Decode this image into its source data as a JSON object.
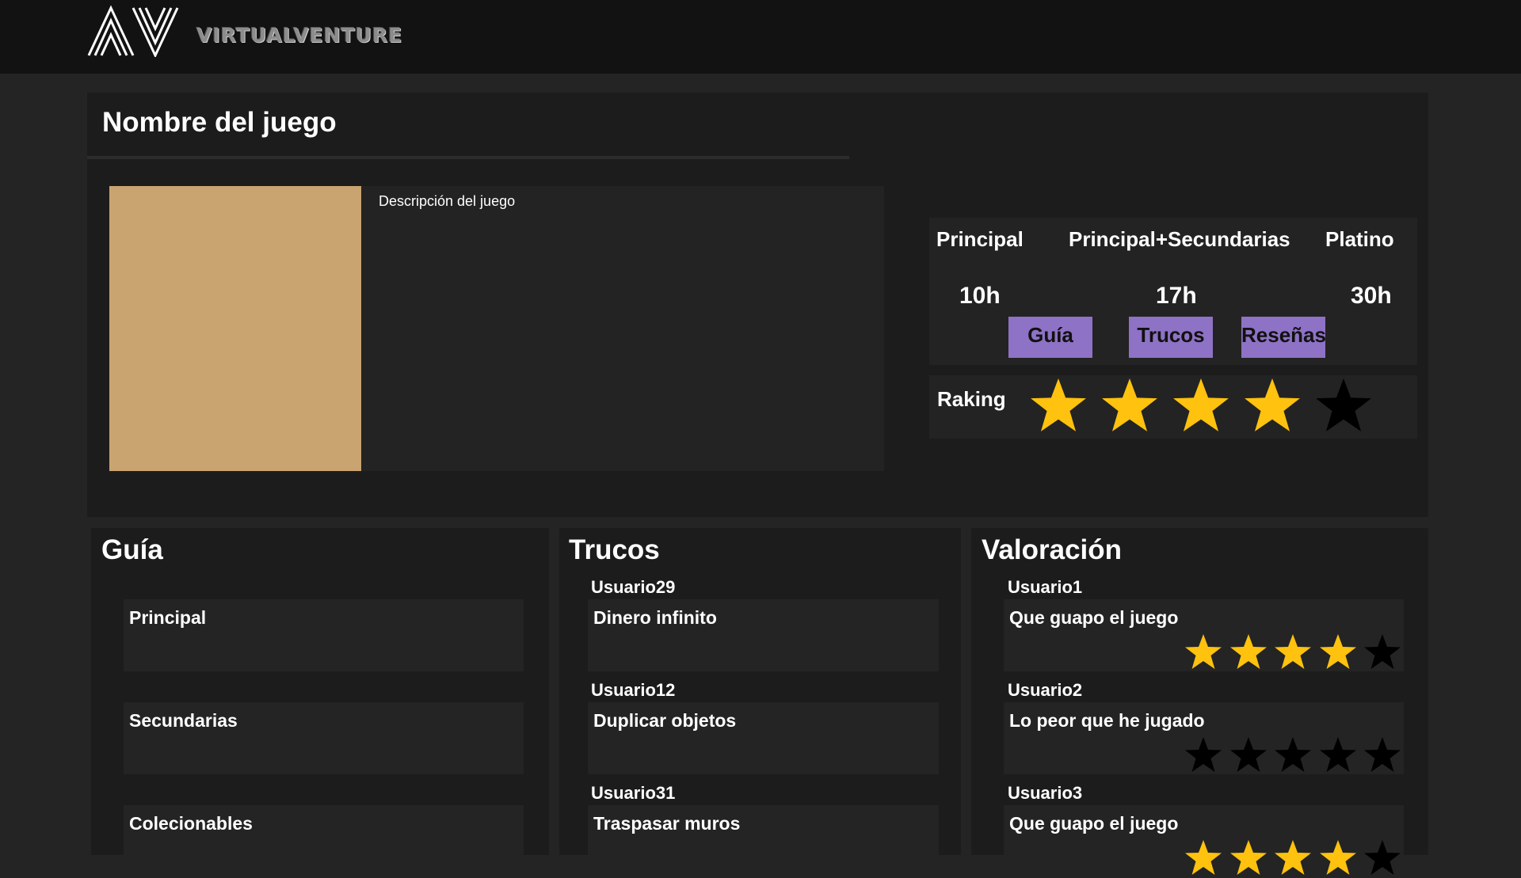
{
  "app": {
    "brand": "VIRTUALVENTURE",
    "logo_icon": "av-logo-icon"
  },
  "game": {
    "title": "Nombre del juego",
    "description": "Descripción del juego",
    "cover_color": "#c9a471"
  },
  "times": {
    "main_label": "Principal",
    "main_value": "10h",
    "extra_label": "Principal+Secundarias",
    "extra_value": "17h",
    "platinum_label": "Platino",
    "platinum_value": "30h"
  },
  "tabs": {
    "guide": "Guía",
    "tricks": "Trucos",
    "reviews": "Reseñas"
  },
  "ranking": {
    "label": "Raking",
    "stars": 4,
    "max": 5
  },
  "guide_section": {
    "title": "Guía",
    "items": [
      "Principal",
      "Secundarias",
      "Colecionables"
    ]
  },
  "tricks_section": {
    "title": "Trucos",
    "items": [
      {
        "user": "Usuario29",
        "text": "Dinero infinito"
      },
      {
        "user": "Usuario12",
        "text": "Duplicar objetos"
      },
      {
        "user": "Usuario31",
        "text": "Traspasar muros"
      }
    ]
  },
  "reviews_section": {
    "title": "Valoración",
    "items": [
      {
        "user": "Usuario1",
        "text": "Que guapo el juego",
        "stars": 4
      },
      {
        "user": "Usuario2",
        "text": "Lo peor que he jugado",
        "stars": 0
      },
      {
        "user": "Usuario3",
        "text": "Que guapo el juego",
        "stars": 4
      }
    ]
  },
  "colors": {
    "accent": "#8e72c5",
    "star_filled": "#ffc20e",
    "star_empty": "#000000"
  }
}
